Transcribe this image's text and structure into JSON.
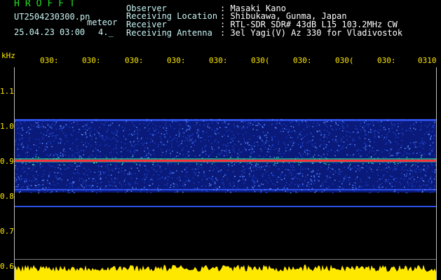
{
  "header": {
    "logo": "HROFFT",
    "filename": "UT2504230300.pn",
    "meteor_label": "meteor",
    "datetime": "25.04.23 03:00",
    "count": "4._",
    "info_labels": [
      "Observer",
      "Receiving Location",
      "Receiver",
      "Receiving Antenna"
    ],
    "info_values": [
      ": Masaki Kano",
      ": Shibukawa, Gunma, Japan",
      ": RTL-SDR SDR# 43dB L15 103.2MHz CW",
      ": 3el Yagi(V) Az 330 for Vladivostok"
    ]
  },
  "axis": {
    "unit": "kHz",
    "y_ticks": [
      "1.1",
      "1.0",
      "0.9",
      "0.8",
      "0.7",
      "0.6"
    ],
    "x_ticks": [
      "030:",
      "030:",
      "030:",
      "030:",
      "030:",
      "030(",
      "030:",
      "030(",
      "030:",
      "0310"
    ]
  },
  "colors": {
    "background": "#000000",
    "noise_band": "#1a3fc8",
    "carrier": "#ff2a3c",
    "amplitude": "#ffe800"
  }
}
